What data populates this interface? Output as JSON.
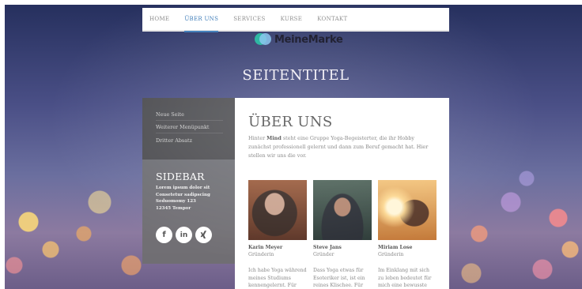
{
  "nav": {
    "items": [
      {
        "label": "HOME",
        "active": false
      },
      {
        "label": "ÜBER UNS",
        "active": true
      },
      {
        "label": "SERVICES",
        "active": false
      },
      {
        "label": "KURSE",
        "active": false
      },
      {
        "label": "KONTAKT",
        "active": false
      }
    ]
  },
  "logo": {
    "text": "MeineMarke"
  },
  "page_title": "SEITENTITEL",
  "subnav": {
    "items": [
      "Neue Seite",
      "Weiterer Menüpunkt",
      "Dritter Absatz"
    ]
  },
  "sidebar": {
    "title": "SIDEBAR",
    "lines": [
      "Lorem ipsum dolor sit",
      "Consetetur sadipscing",
      "Seduomomy 123",
      "12345 Tempor"
    ],
    "social_icons": [
      "facebook-icon",
      "linkedin-icon",
      "xing-icon"
    ],
    "social_labels": [
      "f",
      "in"
    ]
  },
  "main": {
    "heading": "ÜBER UNS",
    "intro_before": "Hinter ",
    "intro_bold": "Mind",
    "intro_after": " steht eine Gruppe Yoga-Begeisterter, die ihr Hobby zunächst professionell gelernt und dann zum Beruf gemacht hat. Hier stellen wir uns die vor.",
    "team": [
      {
        "name": "Karin Meyer",
        "role": "Gründerin",
        "text": "Ich habe Yoga während meines Studiums kennengelernt. Für mich"
      },
      {
        "name": "Steve Jans",
        "role": "Gründer",
        "text": "Dass Yoga etwas für Esoteriker ist, ist ein reines Klischee. Für mich"
      },
      {
        "name": "Miriam Lose",
        "role": "Gründerin",
        "text": "Im Einklang mit sich zu leben bedeutet für mich eine bewusste Ernährung,"
      }
    ]
  },
  "colors": {
    "accent": "#3a7ab8",
    "panel_dark": "#4a4a4a",
    "panel_mid": "#6e6e6e"
  }
}
